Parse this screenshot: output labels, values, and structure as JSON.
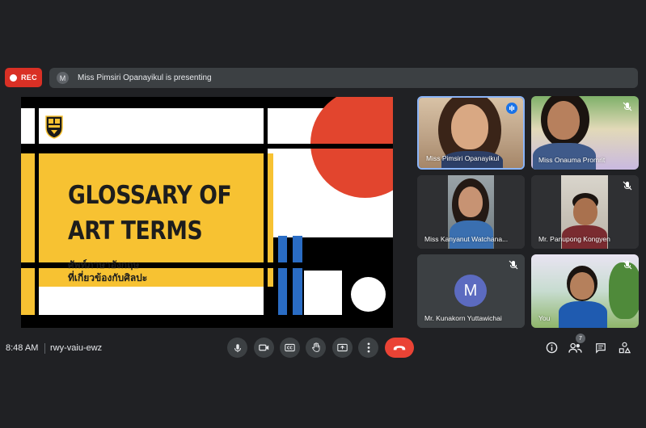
{
  "recording": {
    "label": "REC"
  },
  "presenting_bar": {
    "avatar_initial": "M",
    "message": "Miss Pimsiri Opanayikul is presenting"
  },
  "slide": {
    "title_line1": "GLOSSARY OF",
    "title_line2": "ART TERMS",
    "subtitle_line1": "ศัพท์ภาษาอังกฤษ",
    "subtitle_line2": "ที่เกี่ยวข้องกับศิลปะ"
  },
  "participants": [
    {
      "name": "Miss Pimsiri Opanayikul",
      "speaking": true,
      "muted": false
    },
    {
      "name": "Miss Onauma Promrit",
      "speaking": false,
      "muted": true
    },
    {
      "name": "Miss Kanyanut Watchana...",
      "speaking": false,
      "muted": false
    },
    {
      "name": "Mr. Panupong Kongyen",
      "speaking": false,
      "muted": true
    },
    {
      "name": "Mr. Kunakorn Yuttawichai",
      "avatar_initial": "M",
      "camera_off": true,
      "muted": true
    },
    {
      "name": "You",
      "speaking": false,
      "muted": true
    }
  ],
  "meeting": {
    "time": "8:48 AM",
    "code": "rwy-vaiu-ewz",
    "people_count": "7"
  },
  "controls": [
    "microphone",
    "camera",
    "captions",
    "raise-hand",
    "present-screen",
    "more-options",
    "leave-call"
  ],
  "right_controls": [
    "info",
    "people",
    "chat",
    "activities"
  ],
  "colors": {
    "background": "#202124",
    "rec_red": "#d93025",
    "end_call": "#ea4335",
    "speaking_border": "#8ab4f8",
    "slide_yellow": "#f7c232",
    "slide_red": "#e2452e",
    "slide_blue": "#2a6cc4",
    "avatar_purple": "#5c6bc0"
  }
}
